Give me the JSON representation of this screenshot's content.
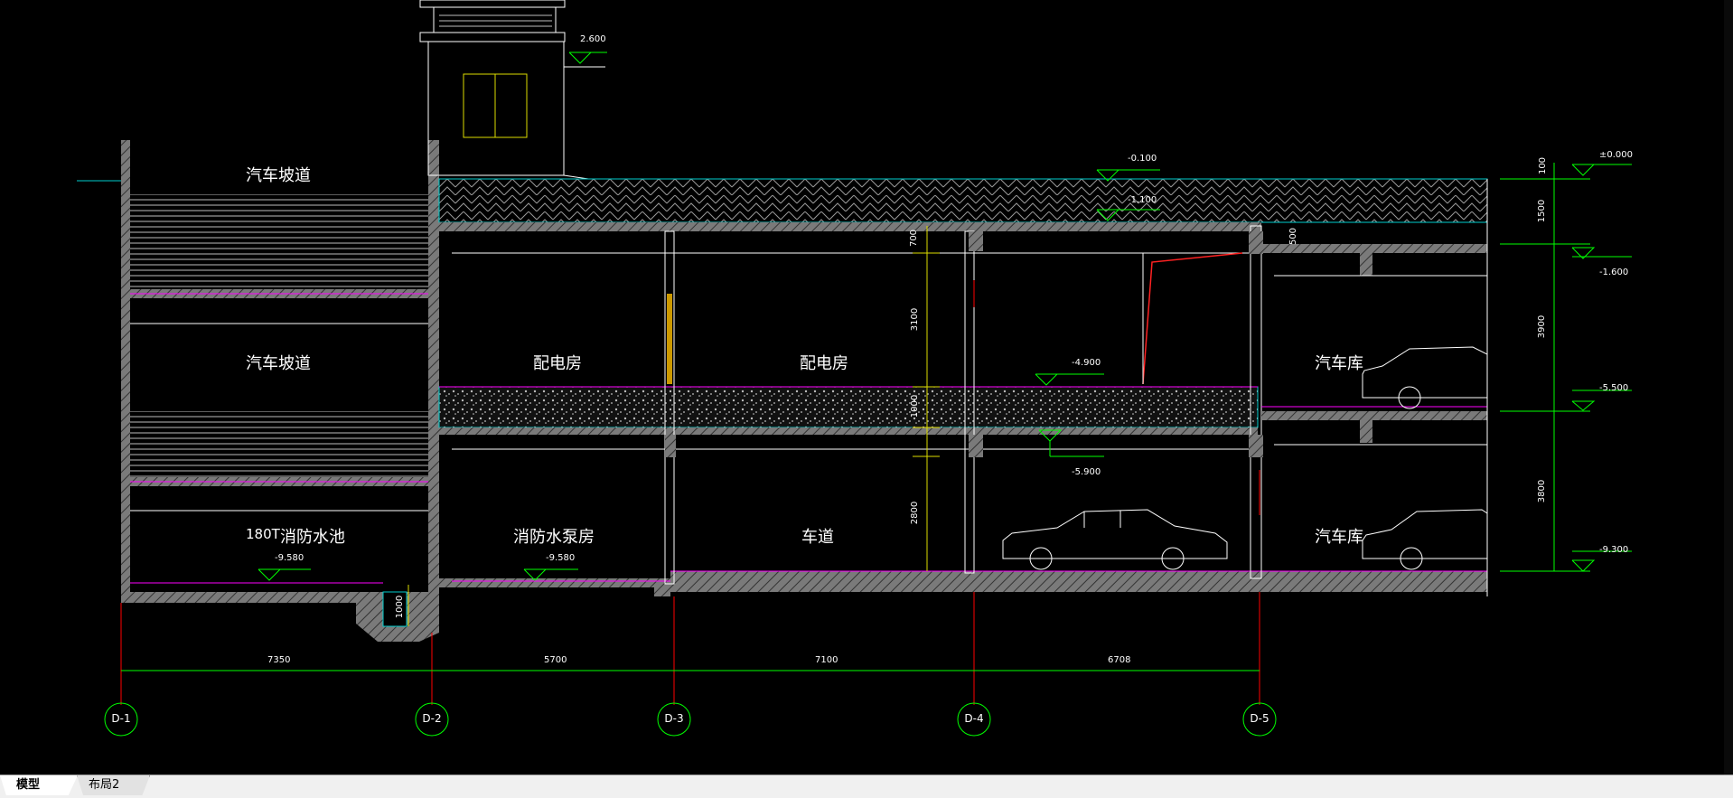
{
  "tabs": [
    {
      "label": "模型",
      "active": true
    },
    {
      "label": "布局2",
      "active": false
    }
  ],
  "rooms": {
    "ramp_top": "汽车坡道",
    "ramp_mid": "汽车坡道",
    "pool_capacity": "180T",
    "pool": "消防水池",
    "distribution_room_1": "配电房",
    "distribution_room_2": "配电房",
    "garage_upper": "汽车库",
    "pump_room": "消防水泵房",
    "driveway": "车道",
    "garage_lower": "汽车库"
  },
  "elevations": {
    "roof": "2.600",
    "el_minus_0_100": "-0.100",
    "el_minus_1_100": "-1.100",
    "el_minus_4_900": "-4.900",
    "el_minus_5_900": "-5.900",
    "el_pool_floor": "-9.580",
    "el_pump_floor": "-9.580",
    "right_0": "±0.000",
    "right_1_600": "-1.600",
    "right_5_500": "-5.500",
    "right_9_300": "-9.300"
  },
  "dimensions": {
    "spans": [
      "7350",
      "5700",
      "7100",
      "6708"
    ],
    "vertical_mid": [
      "700",
      "3100",
      "1000",
      "2800"
    ],
    "sump": "1000",
    "beam": "500",
    "right_side": [
      "100",
      "1500",
      "3900",
      "3800"
    ]
  },
  "axes": [
    "D-1",
    "D-2",
    "D-3",
    "D-4",
    "D-5"
  ],
  "colors": {
    "background": "#000000",
    "wall": "#808080",
    "cyan": "#00cccc",
    "green": "#00ff00",
    "red": "#ff0000",
    "white": "#ffffff",
    "yellow": "#ffff00",
    "magenta": "#ff00ff"
  }
}
